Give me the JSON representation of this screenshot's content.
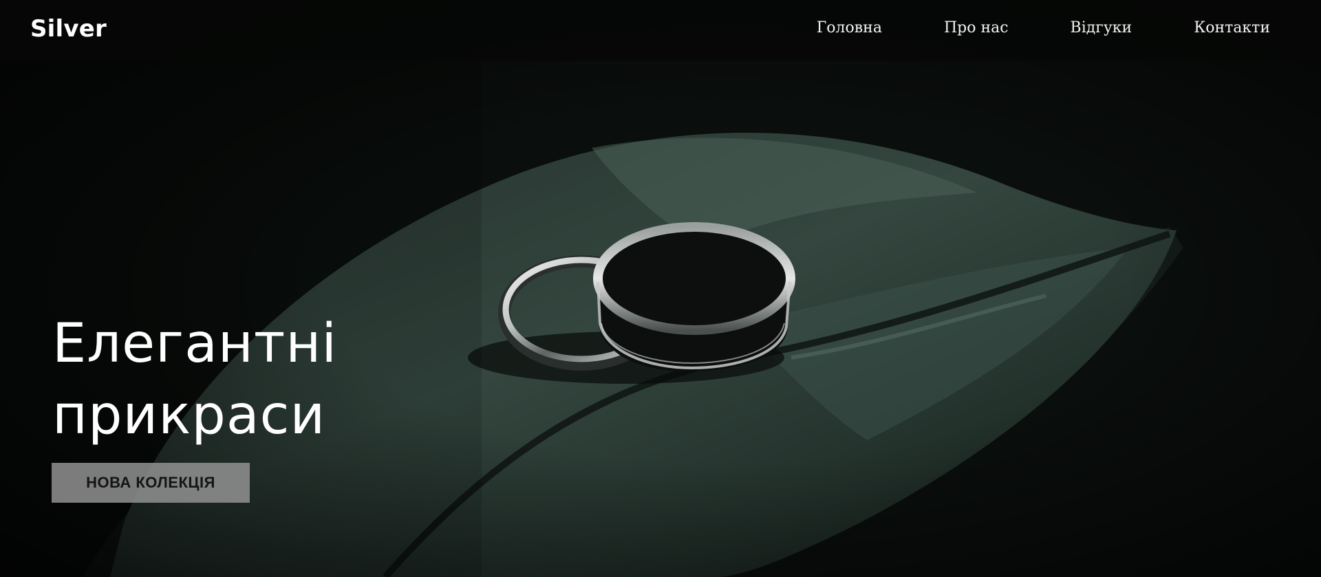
{
  "brand": {
    "logo": "Silver"
  },
  "nav": {
    "items": [
      {
        "label": "Головна"
      },
      {
        "label": "Про нас"
      },
      {
        "label": "Відгуки"
      },
      {
        "label": "Контакти"
      }
    ]
  },
  "hero": {
    "title_line1": "Елегантні",
    "title_line2": "прикраси",
    "cta_label": "НОВА КОЛЕКЦІЯ",
    "image_icon": "wedding-rings-on-leaf-photo"
  },
  "colors": {
    "header_bg": "#060706",
    "text": "#ffffff",
    "cta_bg": "#969696",
    "cta_text": "#141414",
    "leaf": "#2a3a33"
  }
}
